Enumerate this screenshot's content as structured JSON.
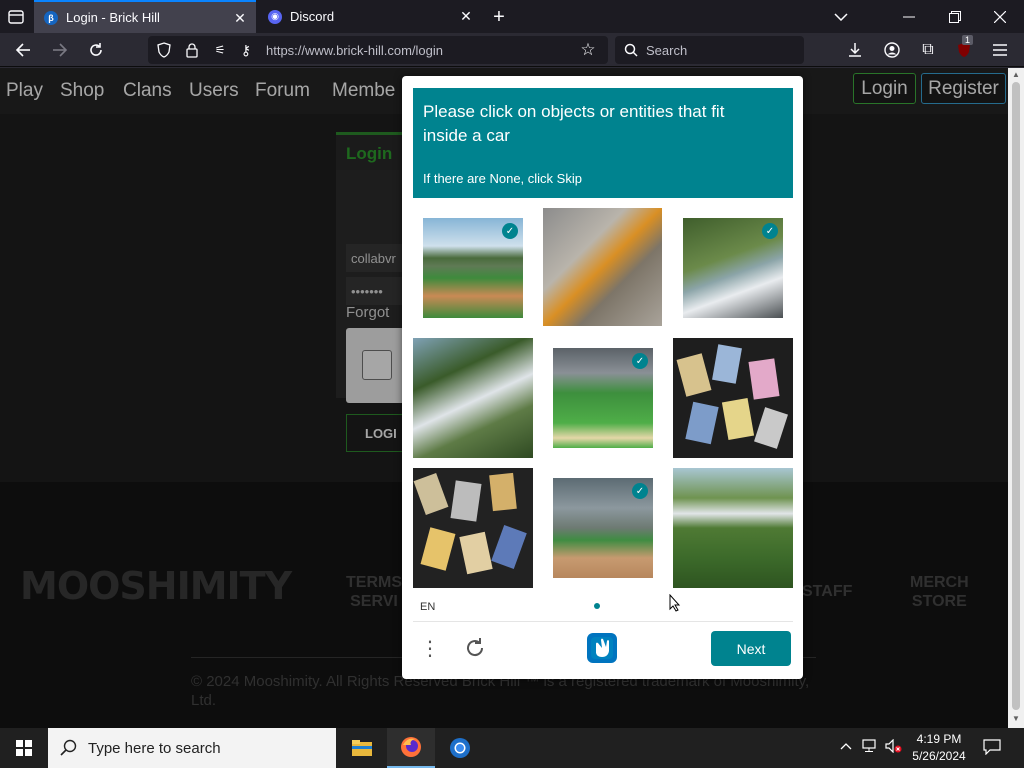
{
  "browser": {
    "tabs": [
      {
        "title": "Login - Brick Hill",
        "favicon": "brick-hill-icon",
        "active": true
      },
      {
        "title": "Discord",
        "favicon": "discord-icon",
        "active": false
      }
    ],
    "url": "https://www.brick-hill.com/login",
    "search_placeholder": "Search",
    "extension_badge": "1"
  },
  "site": {
    "nav": [
      "Play",
      "Shop",
      "Clans",
      "Users",
      "Forum",
      "Membe"
    ],
    "login_label": "Login",
    "register_label": "Register",
    "login_form": {
      "tab": "Login",
      "username_value": "collabvr",
      "password_value": "•••••••",
      "forgot": "Forgot",
      "submit": "LOGI"
    },
    "footer": {
      "logo": "MOOSHIMITY",
      "links": [
        {
          "line1": "TERMS",
          "line2": "SERVI"
        },
        {
          "line1": "STAFF",
          "line2": ""
        },
        {
          "line1": "MERCH",
          "line2": "STORE"
        }
      ],
      "copyright": "© 2024 Mooshimity. All Rights Reserved Brick Hill ™ is a registered trademark of Mooshimity, Ltd."
    }
  },
  "captcha": {
    "prompt": "Please click on objects or entities that fit inside a car",
    "hint": "If there are None, click Skip",
    "language": "EN",
    "next_label": "Next",
    "accent": "#00838f",
    "grid": [
      {
        "subject": "baseball stadium",
        "selected": true
      },
      {
        "subject": "excavator construction site",
        "selected": false
      },
      {
        "subject": "train in mountains",
        "selected": true
      },
      {
        "subject": "train on bridge",
        "selected": false
      },
      {
        "subject": "baseball field",
        "selected": true
      },
      {
        "subject": "tarot cards",
        "selected": false
      },
      {
        "subject": "tarot cards",
        "selected": false
      },
      {
        "subject": "baseball stadium",
        "selected": true
      },
      {
        "subject": "train in forest",
        "selected": false
      }
    ]
  },
  "taskbar": {
    "search_placeholder": "Type here to search",
    "time": "4:19 PM",
    "date": "5/26/2024"
  }
}
